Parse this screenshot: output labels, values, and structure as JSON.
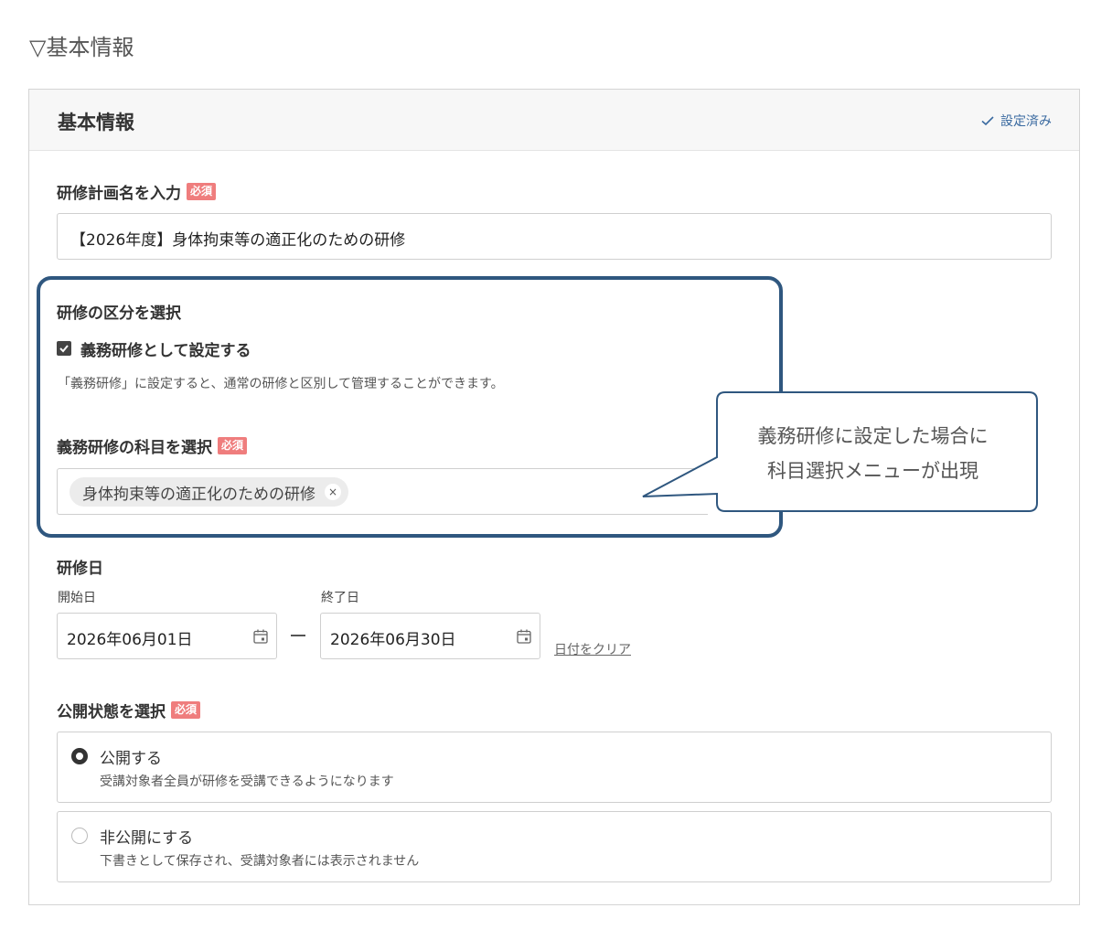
{
  "section_heading": "▽基本情報",
  "card": {
    "title": "基本情報",
    "status": "設定済み"
  },
  "plan_name": {
    "label": "研修計画名を入力",
    "required": "必須",
    "value": "【2026年度】身体拘束等の適正化のための研修"
  },
  "category": {
    "label": "研修の区分を選択",
    "checkbox_label": "義務研修として設定する",
    "checked": true,
    "help": "「義務研修」に設定すると、通常の研修と区別して管理することができます。"
  },
  "subject": {
    "label": "義務研修の科目を選択",
    "required": "必須",
    "chip": "身体拘束等の適正化のための研修",
    "chip_remove": "×"
  },
  "callout": {
    "line1": "義務研修に設定した場合に",
    "line2": "科目選択メニューが出現"
  },
  "dates": {
    "label": "研修日",
    "start_label": "開始日",
    "start_value": "2026年06月01日",
    "end_label": "終了日",
    "end_value": "2026年06月30日",
    "clear_link": "日付をクリア"
  },
  "visibility": {
    "label": "公開状態を選択",
    "required": "必須",
    "options": [
      {
        "title": "公開する",
        "desc": "受講対象者全員が研修を受講できるようになります",
        "selected": true
      },
      {
        "title": "非公開にする",
        "desc": "下書きとして保存され、受講対象者には表示されません",
        "selected": false
      }
    ]
  },
  "colors": {
    "accent": "#2f577f",
    "required_badge": "#ef7d7d",
    "status_link": "#3a6aa0"
  }
}
